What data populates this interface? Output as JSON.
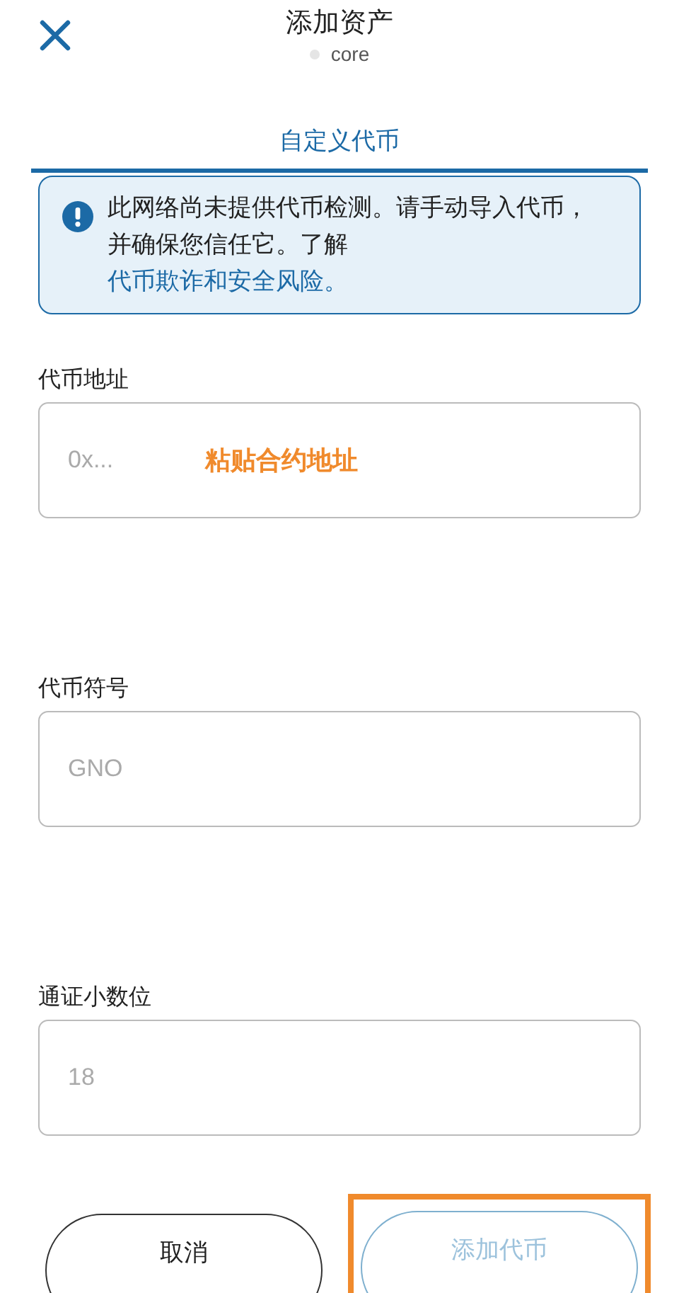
{
  "header": {
    "title": "添加资产",
    "network": "core"
  },
  "tabs": [
    {
      "label": "自定义代币",
      "selected": true
    }
  ],
  "notice": {
    "text": "此网络尚未提供代币检测。请手动导入代币，并确保您信任它。了解 ",
    "link": "代币欺诈和安全风险。"
  },
  "fields": [
    {
      "label": "代币地址",
      "placeholder": "0x...",
      "annotation": "粘贴合约地址"
    },
    {
      "label": "代币符号",
      "placeholder": "GNO"
    },
    {
      "label": "通证小数位",
      "placeholder": "18"
    }
  ],
  "buttons": [
    {
      "label": "取消",
      "kind": "secondary",
      "disabled": false,
      "highlighted": false
    },
    {
      "label": "添加代币",
      "kind": "primary",
      "disabled": true,
      "highlighted": true
    }
  ]
}
